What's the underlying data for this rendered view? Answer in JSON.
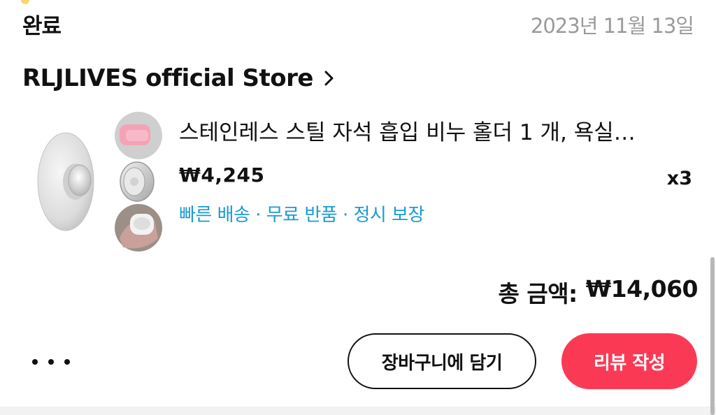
{
  "order": {
    "status": "완료",
    "date": "2023년 11월 13일"
  },
  "store": {
    "name": "RLJLIVES official Store",
    "icon": "chevron-right-icon"
  },
  "product": {
    "title": "스테인레스 스틸 자석 흡입 비누 홀더 1 개, 욕실…",
    "price": "₩4,245",
    "quantity": "x3",
    "benefits": "빠른 배송 · 무료 반품 · 정시 보장"
  },
  "summary": {
    "total_label": "총 금액:",
    "total_value": "₩14,060"
  },
  "actions": {
    "more_icon": "more-dots-icon",
    "cart_label": "장바구니에 담기",
    "review_label": "리뷰 작성"
  },
  "colors": {
    "accent": "#fa3a55",
    "benefit_text": "#1a9ad6",
    "date_text": "#9a9a9a"
  }
}
